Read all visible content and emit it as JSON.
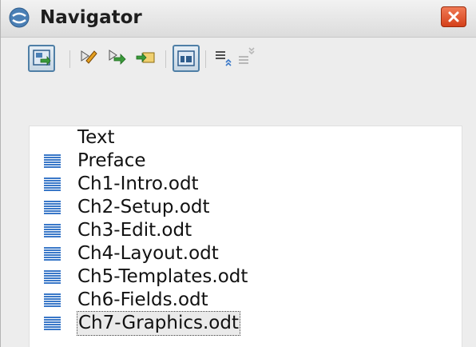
{
  "window": {
    "title": "Navigator",
    "title_icon": "navigator-icon",
    "close_icon": "close-icon",
    "close_color": "#d94a22"
  },
  "toolbar": {
    "buttons": [
      {
        "icon": "toggle-icon",
        "pressed": true
      },
      {
        "icon": "edit-icon",
        "pressed": false
      },
      {
        "icon": "open-icon",
        "pressed": false
      },
      {
        "icon": "insert-icon",
        "pressed": false
      },
      {
        "icon": "content-view-icon",
        "pressed": true
      },
      {
        "icon": "promote-level-icon",
        "pressed": false
      },
      {
        "icon": "demote-level-icon",
        "pressed": false
      }
    ]
  },
  "list": {
    "items": [
      {
        "label": "Text",
        "icon": null,
        "selected": false
      },
      {
        "label": "Preface",
        "icon": "document-icon",
        "selected": false
      },
      {
        "label": "Ch1-Intro.odt",
        "icon": "document-icon",
        "selected": false
      },
      {
        "label": "Ch2-Setup.odt",
        "icon": "document-icon",
        "selected": false
      },
      {
        "label": "Ch3-Edit.odt",
        "icon": "document-icon",
        "selected": false
      },
      {
        "label": "Ch4-Layout.odt",
        "icon": "document-icon",
        "selected": false
      },
      {
        "label": "Ch5-Templates.odt",
        "icon": "document-icon",
        "selected": false
      },
      {
        "label": "Ch6-Fields.odt",
        "icon": "document-icon",
        "selected": false
      },
      {
        "label": "Ch7-Graphics.odt",
        "icon": "document-icon",
        "selected": true
      }
    ]
  },
  "colors": {
    "accent": "#3a78c8",
    "pressed_border": "#4f7fa6"
  }
}
